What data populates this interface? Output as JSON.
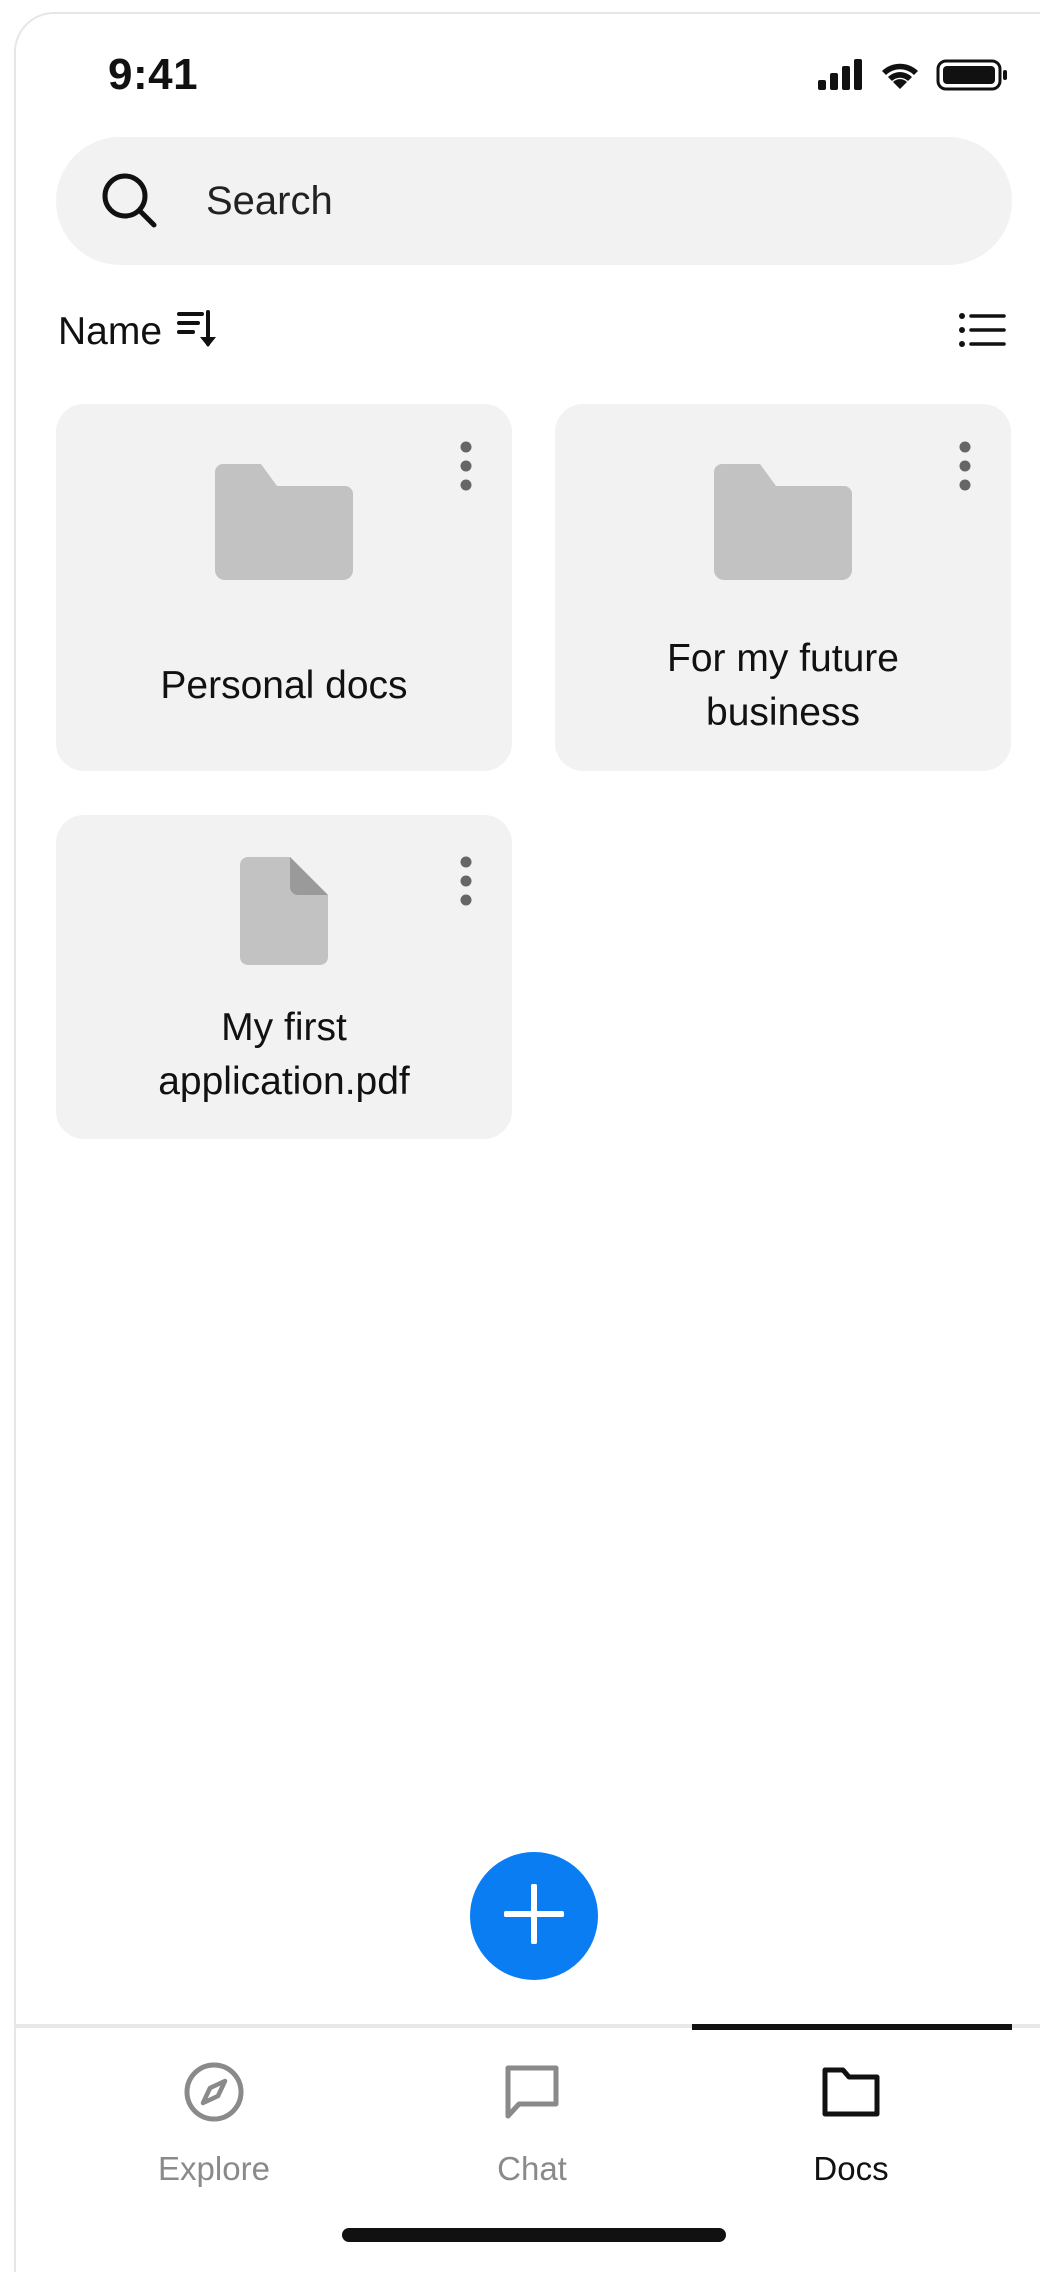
{
  "status_bar": {
    "time": "9:41",
    "icons": [
      "signal-icon",
      "wifi-icon",
      "battery-icon"
    ]
  },
  "search": {
    "placeholder": "Search",
    "icon": "search-icon"
  },
  "sort": {
    "label": "Name",
    "icon": "sort-descending-icon"
  },
  "view_toggle": {
    "icon": "list-view-icon"
  },
  "items": [
    {
      "type": "folder",
      "title": "Personal docs",
      "icon": "folder-icon"
    },
    {
      "type": "folder",
      "title": "For my future business",
      "icon": "folder-icon"
    },
    {
      "type": "file",
      "title": "My first application.pdf",
      "icon": "file-icon"
    }
  ],
  "fab": {
    "icon": "plus-icon"
  },
  "tabs": [
    {
      "label": "Explore",
      "icon": "compass-icon",
      "active": false
    },
    {
      "label": "Chat",
      "icon": "chat-bubble-icon",
      "active": false
    },
    {
      "label": "Docs",
      "icon": "folder-icon",
      "active": true
    }
  ],
  "colors": {
    "accent": "#0a7df2",
    "card_background": "#f2f2f2",
    "thumbnail_gray": "#c2c2c2",
    "inactive_tab": "#8a8a8a"
  }
}
